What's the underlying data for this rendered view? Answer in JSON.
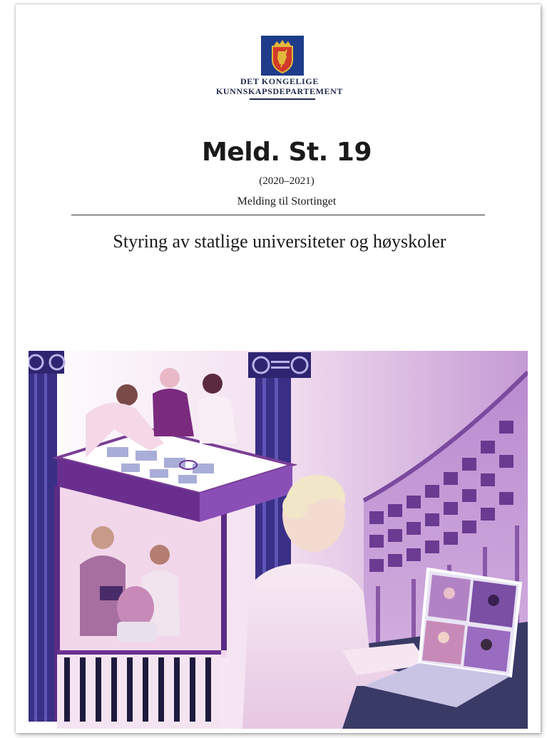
{
  "ministry": {
    "line1": "DET KONGELIGE",
    "line2": "KUNNSKAPSDEPARTEMENT",
    "crest_icon": "norwegian-coat-of-arms-icon"
  },
  "document": {
    "title": "Meld. St. 19",
    "years": "(2020–2021)",
    "kind": "Melding til Stortinget",
    "subtitle": "Styring av statlige universiteter og høyskoler"
  },
  "illustration": {
    "subject": "people-collaborating-and-videoconferencing-illustration",
    "palette": {
      "purple": "#5b2a86",
      "violet": "#8a4fb6",
      "pink": "#e9c6e4",
      "navy": "#2a2a72"
    }
  }
}
